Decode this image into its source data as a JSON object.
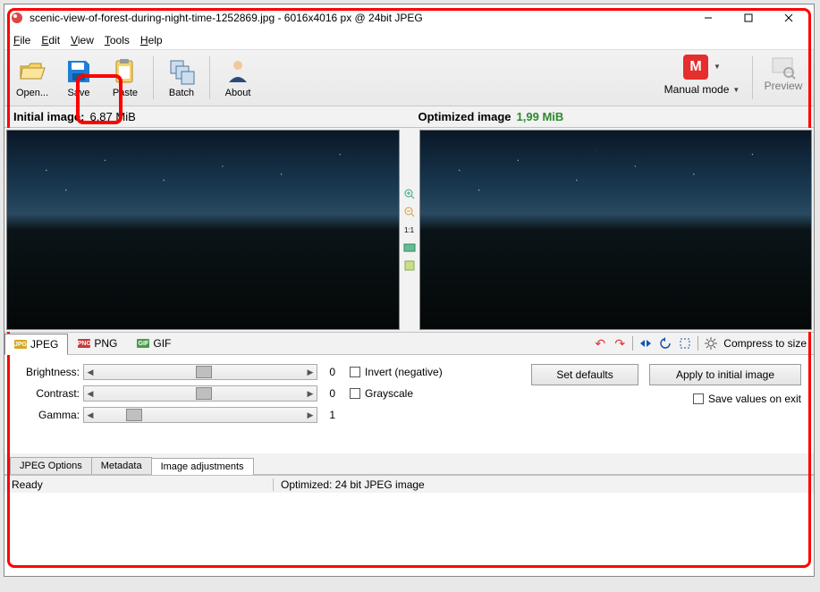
{
  "window": {
    "title": "scenic-view-of-forest-during-night-time-1252869.jpg - 6016x4016 px @ 24bit JPEG"
  },
  "menu": {
    "file": "File",
    "edit": "Edit",
    "view": "View",
    "tools": "Tools",
    "help": "Help"
  },
  "toolbar": {
    "open": "Open...",
    "save": "Save",
    "paste": "Paste",
    "batch": "Batch",
    "about": "About",
    "mode_letter": "M",
    "mode_label": "Manual mode",
    "preview": "Preview"
  },
  "headers": {
    "initial_label": "Initial image:",
    "initial_size": "6,87 MiB",
    "optimized_label": "Optimized image",
    "optimized_size": "1,99 MiB"
  },
  "midtools": {
    "ratio": "1:1"
  },
  "formats": {
    "jpeg": "JPEG",
    "png": "PNG",
    "gif": "GIF",
    "compress": "Compress to size"
  },
  "adjust": {
    "brightness_label": "Brightness:",
    "brightness_val": "0",
    "contrast_label": "Contrast:",
    "contrast_val": "0",
    "gamma_label": "Gamma:",
    "gamma_val": "1",
    "invert": "Invert (negative)",
    "grayscale": "Grayscale",
    "set_defaults": "Set defaults",
    "apply": "Apply to initial image",
    "save_on_exit": "Save values on exit"
  },
  "tabs": {
    "jpeg_opts": "JPEG Options",
    "metadata": "Metadata",
    "img_adjust": "Image adjustments"
  },
  "status": {
    "ready": "Ready",
    "info": "Optimized: 24 bit JPEG image"
  }
}
